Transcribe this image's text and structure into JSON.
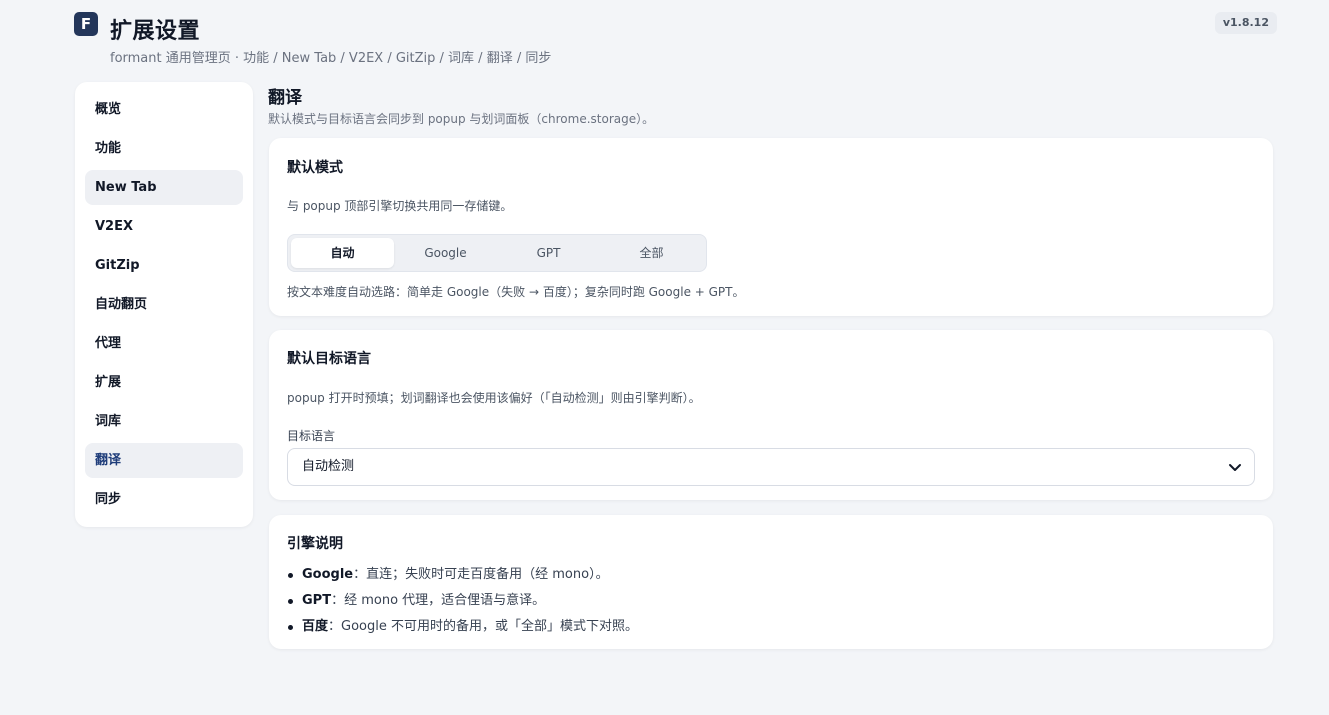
{
  "header": {
    "logo_letter": "F",
    "title": "扩展设置",
    "breadcrumb": "formant 通用管理页 · 功能 / New Tab / V2EX / GitZip / 词库 / 翻译 / 同步",
    "version": "v1.8.12"
  },
  "sidebar": {
    "items": [
      {
        "label": "概览"
      },
      {
        "label": "功能"
      },
      {
        "label": "New Tab"
      },
      {
        "label": "V2EX"
      },
      {
        "label": "GitZip"
      },
      {
        "label": "自动翻页"
      },
      {
        "label": "代理"
      },
      {
        "label": "扩展"
      },
      {
        "label": "词库"
      },
      {
        "label": "翻译"
      },
      {
        "label": "同步"
      }
    ],
    "active": "翻译"
  },
  "main": {
    "title": "翻译",
    "description": "默认模式与目标语言会同步到 popup 与划词面板（chrome.storage）。",
    "default_mode": {
      "title": "默认模式",
      "description": "与 popup 顶部引擎切换共用同一存储键。",
      "options": [
        "自动",
        "Google",
        "GPT",
        "全部"
      ],
      "selected": "自动",
      "hint": "按文本难度自动选路：简单走 Google（失败 → 百度）；复杂同时跑 Google + GPT。"
    },
    "target_language": {
      "title": "默认目标语言",
      "description": "popup 打开时预填；划词翻译也会使用该偏好（「自动检测」则由引擎判断）。",
      "field_label": "目标语言",
      "selected_value": "自动检测"
    },
    "engines": {
      "title": "引擎说明",
      "items": [
        {
          "name": "Google",
          "desc": "：直连；失败时可走百度备用（经 mono）。"
        },
        {
          "name": "GPT",
          "desc": "：经 mono 代理，适合俚语与意译。"
        },
        {
          "name": "百度",
          "desc": "：Google 不可用时的备用，或「全部」模式下对照。"
        }
      ]
    }
  },
  "colors": {
    "accent": "#23365a",
    "background": "#f3f5f8",
    "active_nav_text": "#1f3d7a"
  }
}
